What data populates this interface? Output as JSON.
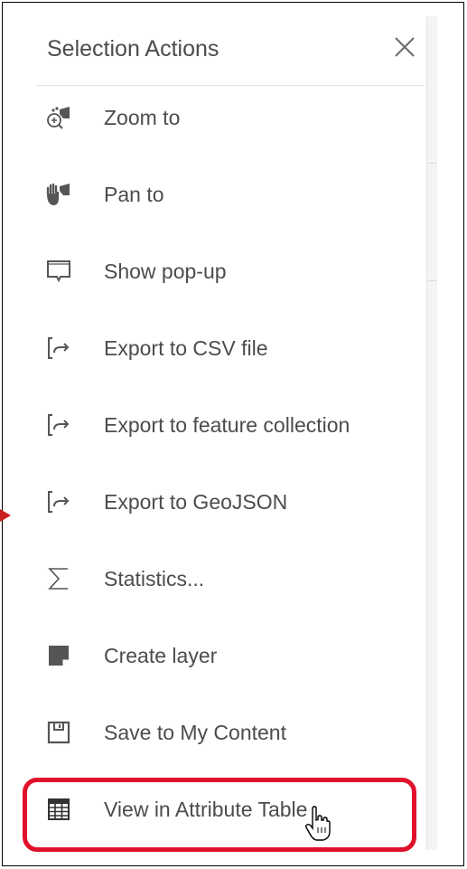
{
  "panel": {
    "title": "Selection Actions",
    "close_icon": "close-icon"
  },
  "actions": [
    {
      "label": "Zoom to",
      "icon": "zoom-to-icon"
    },
    {
      "label": "Pan to",
      "icon": "pan-to-icon"
    },
    {
      "label": "Show pop-up",
      "icon": "popup-icon"
    },
    {
      "label": "Export to CSV file",
      "icon": "export-icon"
    },
    {
      "label": "Export to feature collection",
      "icon": "export-icon"
    },
    {
      "label": "Export to GeoJSON",
      "icon": "export-icon"
    },
    {
      "label": "Statistics...",
      "icon": "sigma-icon"
    },
    {
      "label": "Create layer",
      "icon": "create-layer-icon"
    },
    {
      "label": "Save to My Content",
      "icon": "save-icon"
    },
    {
      "label": "View in Attribute Table",
      "icon": "table-icon"
    }
  ],
  "highlighted_action": "View in Attribute Table",
  "colors": {
    "text": "#4c4c4c",
    "icon": "#555555",
    "highlight": "#e0112b",
    "arrow": "#cc1f1f"
  }
}
